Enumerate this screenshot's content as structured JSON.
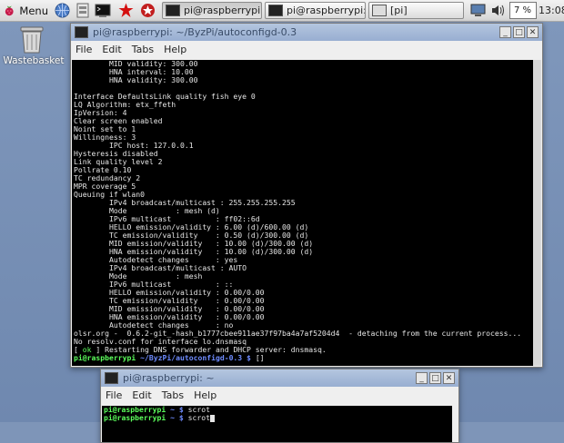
{
  "taskbar": {
    "menu_label": "Menu",
    "tasks": [
      {
        "label": "pi@raspberrypi: ~/..."
      },
      {
        "label": "pi@raspberrypi: ~"
      },
      {
        "label": "[pi]"
      }
    ],
    "cpu_percent": "7 %",
    "clock": "13:08"
  },
  "desktop": {
    "wastebasket_label": "Wastebasket"
  },
  "main_window": {
    "title": "pi@raspberrypi: ~/ByzPi/autoconfigd-0.3",
    "menu": [
      "File",
      "Edit",
      "Tabs",
      "Help"
    ],
    "lines": [
      "        MID validity: 300.00",
      "        HNA interval: 10.00",
      "        HNA validity: 300.00",
      "",
      "Interface DefaultsLink quality fish eye 0",
      "LQ Algorithm: etx_ffeth",
      "IpVersion: 4",
      "Clear screen enabled",
      "Noint set to 1",
      "Willingness: 3",
      "        IPC host: 127.0.0.1",
      "Hysteresis disabled",
      "Link quality level 2",
      "Pollrate 0.10",
      "TC redundancy 2",
      "MPR coverage 5",
      "Queuing if wlan0",
      "        IPv4 broadcast/multicast : 255.255.255.255",
      "        Mode           : mesh (d)",
      "        IPv6 multicast          : ff02::6d",
      "        HELLO emission/validity : 6.00 (d)/600.00 (d)",
      "        TC emission/validity    : 0.50 (d)/300.00 (d)",
      "        MID emission/validity   : 10.00 (d)/300.00 (d)",
      "        HNA emission/validity   : 10.00 (d)/300.00 (d)",
      "        Autodetect changes      : yes",
      "        IPv4 broadcast/multicast : AUTO",
      "        Mode           : mesh",
      "        IPv6 multicast          : ::",
      "        HELLO emission/validity : 0.00/0.00",
      "        TC emission/validity    : 0.00/0.00",
      "        MID emission/validity   : 0.00/0.00",
      "        HNA emission/validity   : 0.00/0.00",
      "        Autodetect changes      : no",
      "olsr.org -  0.6.2-git_-hash_b1777cbee911ae37f97ba4a7af5204d4  - detaching from the current process...",
      "No resolv.conf for interface lo.dnsmasq"
    ],
    "status_line": {
      "open": "[ ",
      "ok": "ok",
      "close": " ] ",
      "text": "Restarting DNS forwarder and DHCP server: dnsmasq."
    },
    "prompt": {
      "user": "pi@raspberrypi",
      "path": " ~/ByzPi/autoconfigd-0.3 $ ",
      "cursor": "[]"
    }
  },
  "second_window": {
    "title": "pi@raspberrypi: ~",
    "menu": [
      "File",
      "Edit",
      "Tabs",
      "Help"
    ],
    "prompt_user": "pi@raspberrypi",
    "prompt_path": " ~ $ ",
    "commands": [
      "scrot",
      "scrot"
    ]
  }
}
